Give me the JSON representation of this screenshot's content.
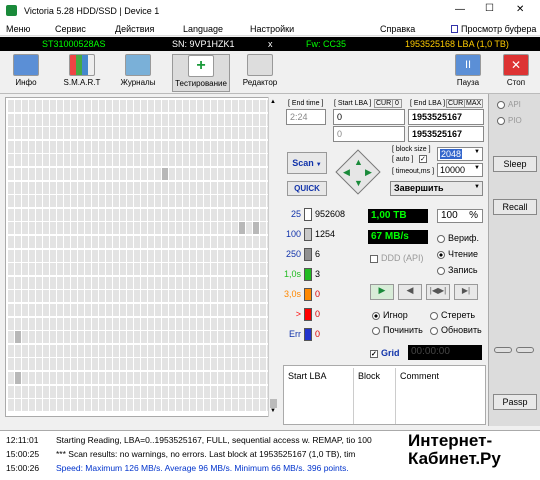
{
  "window": {
    "title": "Victoria 5.28 HDD/SSD | Device 1",
    "minimize": "—",
    "maximize": "☐",
    "close": "✕"
  },
  "menu": {
    "items": [
      "Меню",
      "Сервис",
      "Действия",
      "Language",
      "Настройки",
      "Справка"
    ],
    "buffer": "Просмотр буфера"
  },
  "device": {
    "model": "ST31000528AS",
    "serial": "SN: 9VP1HZK1",
    "x": "x",
    "fw": "Fw: CC35",
    "lba": "1953525168 LBA (1,0 TB)"
  },
  "toolbar": {
    "info": "Инфо",
    "smart": "S.M.A.R.T",
    "journals": "Журналы",
    "testing": "Тестирование",
    "editor": "Редактор",
    "pause": "Пауза",
    "stop": "Стоп"
  },
  "scan": {
    "end_time_label": "[ End time ]",
    "end_time": "2:24",
    "start_lba_label": "[ Start LBA ]",
    "cur_label": "CUR",
    "zero_label": "0",
    "start_lba": "0",
    "start_lba2": "0",
    "end_lba_label": "[ End LBA ]",
    "cur2_label": "CUR",
    "max_label": "MAX",
    "end_lba": "1953525167",
    "end_lba2": "1953525167",
    "scan_button": "Scan",
    "quick_button": "QUICK",
    "block_size_label": "[ block size ]",
    "auto_label": "[ auto ]",
    "block_size": "2048",
    "timeout_label": "[ timeout,ms ]",
    "timeout": "10000",
    "finish_label": "Завершить"
  },
  "stats": {
    "rows": [
      {
        "label": "25",
        "value": "952608",
        "color": "#ffffff"
      },
      {
        "label": "100",
        "value": "1254",
        "color": "#c8c8c8"
      },
      {
        "label": "250",
        "value": "6",
        "color": "#909090"
      },
      {
        "label": "1,0s",
        "value": "3",
        "color": "#22bb22"
      },
      {
        "label": "3,0s",
        "value": "0",
        "color": "#ff8800"
      },
      {
        "label": ">",
        "value": "0",
        "color": "#ff0000"
      },
      {
        "label": "Err",
        "value": "0",
        "color": "#2233cc"
      }
    ]
  },
  "progress": {
    "size": "1,00 TB",
    "percent": "100",
    "percent_sign": "%",
    "speed": "67 MB/s",
    "verify": "Вериф.",
    "read": "Чтение",
    "write": "Запись",
    "ddd": "DDD (API)"
  },
  "actions": {
    "ignore": "Игнор",
    "erase": "Стереть",
    "fix": "Починить",
    "update": "Обновить",
    "grid": "Grid",
    "timer": "00:00:00"
  },
  "table": {
    "col_start": "Start LBA",
    "col_block": "Block",
    "col_comment": "Comment"
  },
  "right": {
    "api": "API",
    "pio": "PIO",
    "sleep": "Sleep",
    "recall": "Recall",
    "passp": "Passp"
  },
  "log": [
    {
      "time": "12:11:01",
      "text": "Starting Reading, LBA=0..1953525167, FULL, sequential access w. REMAP, tio 100",
      "color": "#000000"
    },
    {
      "time": "15:00:25",
      "text": "*** Scan results: no warnings, no errors. Last block at 1953525167 (1,0 TB), tim",
      "color": "#000000"
    },
    {
      "time": "15:00:26",
      "text": "Speed: Maximum 126 MB/s. Average 96 MB/s. Minimum 66 MB/s. 396 points.",
      "color": "#0033cc"
    }
  ],
  "watermark": {
    "line1": "Интернет-",
    "line2": "Кабинет.Ру"
  }
}
